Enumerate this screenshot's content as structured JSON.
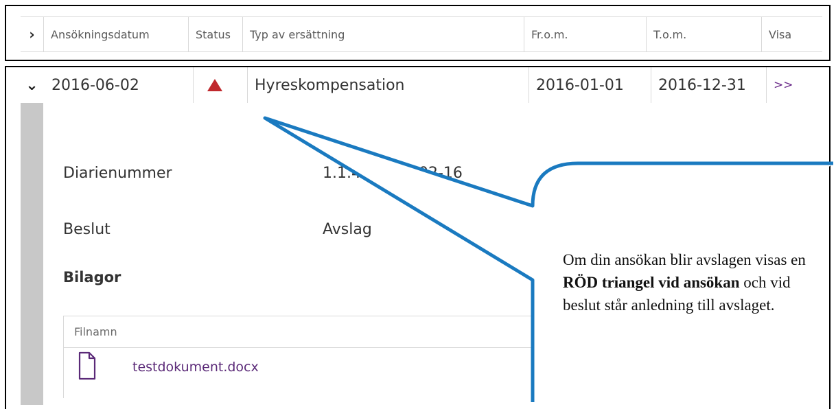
{
  "header": {
    "columns": [
      "Ansökningsdatum",
      "Status",
      "Typ av ersättning",
      "Fr.o.m.",
      "T.o.m.",
      "Visa"
    ],
    "expand_icon": "chevron-right-icon"
  },
  "row": {
    "date": "2016-06-02",
    "status_icon": "red-triangle-icon",
    "status_color": "#c0282d",
    "type": "Hyreskompensation",
    "from": "2016-01-01",
    "to": "2016-12-31",
    "show": ">>",
    "collapse_icon": "chevron-down-icon"
  },
  "details": {
    "diarienummer_label": "Diarienummer",
    "diarienummer_value_start": "1.1.4",
    "diarienummer_value_end": "902-16",
    "beslut_label": "Beslut",
    "beslut_value": "Avslag",
    "bilagor_label": "Bilagor"
  },
  "attachments": {
    "column_header": "Filnamn",
    "files": [
      {
        "name": "testdokument.docx",
        "icon": "document-icon"
      }
    ]
  },
  "callout": {
    "text_1": "Om din ansökan blir avslagen visas en ",
    "text_bold": "RÖD triangel vid ansökan",
    "text_2": " och vid beslut står anledning till avslaget.",
    "border_color": "#1a7ac0"
  }
}
